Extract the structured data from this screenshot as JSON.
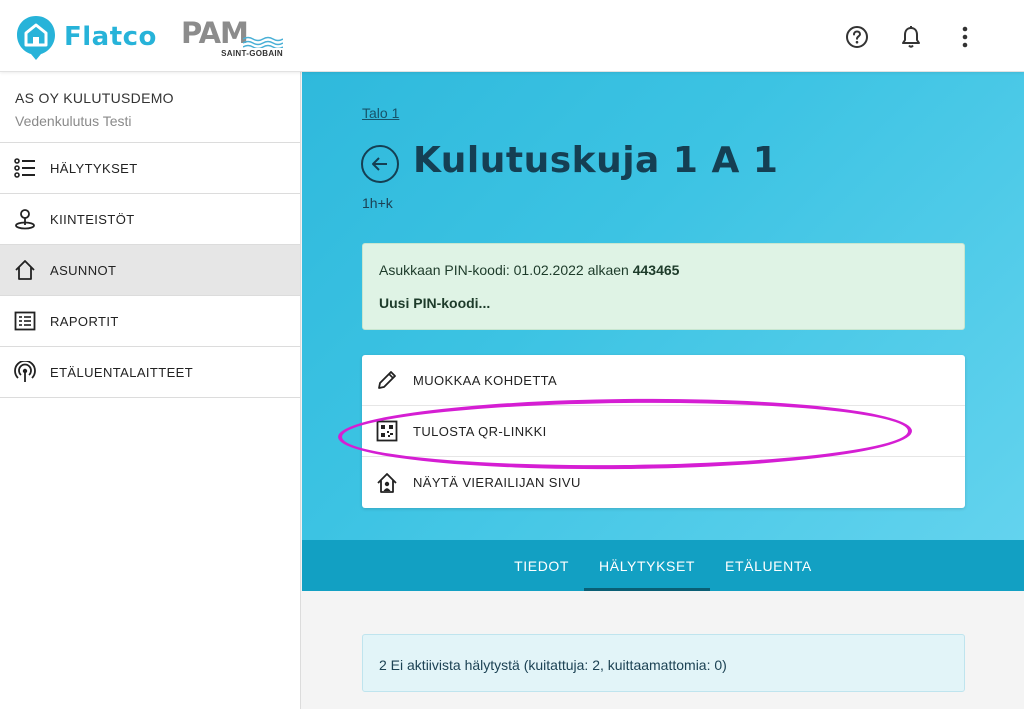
{
  "header": {
    "brand_name": "Flatco",
    "partner_logo": "PAM",
    "partner_sub": "SAINT-GOBAIN",
    "icons": [
      "help-icon",
      "bell-icon",
      "more-vert-icon"
    ],
    "brand_color": "#27b3d9"
  },
  "sidebar": {
    "org_name": "AS OY KULUTUSDEMO",
    "org_sub": "Vedenkulutus Testi",
    "items": [
      {
        "label": "HÄLYTYKSET",
        "icon": "list-icon"
      },
      {
        "label": "KIINTEISTÖT",
        "icon": "map-pin-icon"
      },
      {
        "label": "ASUNNOT",
        "icon": "home-icon",
        "active": true
      },
      {
        "label": "RAPORTIT",
        "icon": "report-icon"
      },
      {
        "label": "ETÄLUENTALAITTEET",
        "icon": "antenna-icon"
      }
    ]
  },
  "main": {
    "breadcrumb": "Talo 1",
    "title": "Kulutuskuja 1 A 1",
    "subtitle": "1h+k",
    "pin": {
      "text": "Asukkaan PIN-koodi: 01.02.2022 alkaen ",
      "code": "443465",
      "new_link": "Uusi PIN-koodi..."
    },
    "actions": [
      {
        "label": "MUOKKAA KOHDETTA",
        "icon": "pencil-icon"
      },
      {
        "label": "TULOSTA QR-LINKKI",
        "icon": "qr-code-icon"
      },
      {
        "label": "NÄYTÄ VIERAILIJAN SIVU",
        "icon": "house-person-icon"
      }
    ],
    "tabs": [
      {
        "label": "TIEDOT"
      },
      {
        "label": "HÄLYTYKSET",
        "active": true
      },
      {
        "label": "ETÄLUENTA"
      }
    ],
    "alerts_info": "2 Ei aktiivista hälytystä (kuitattuja: 2, kuittaamattomia: 0)"
  },
  "colors": {
    "hero_gradient_start": "#2fb9dc",
    "hero_gradient_end": "#63d3ee",
    "tabs_bar": "#12a0c3",
    "highlight_ellipse": "#d51ed3",
    "pin_box": "#dff3e5"
  }
}
